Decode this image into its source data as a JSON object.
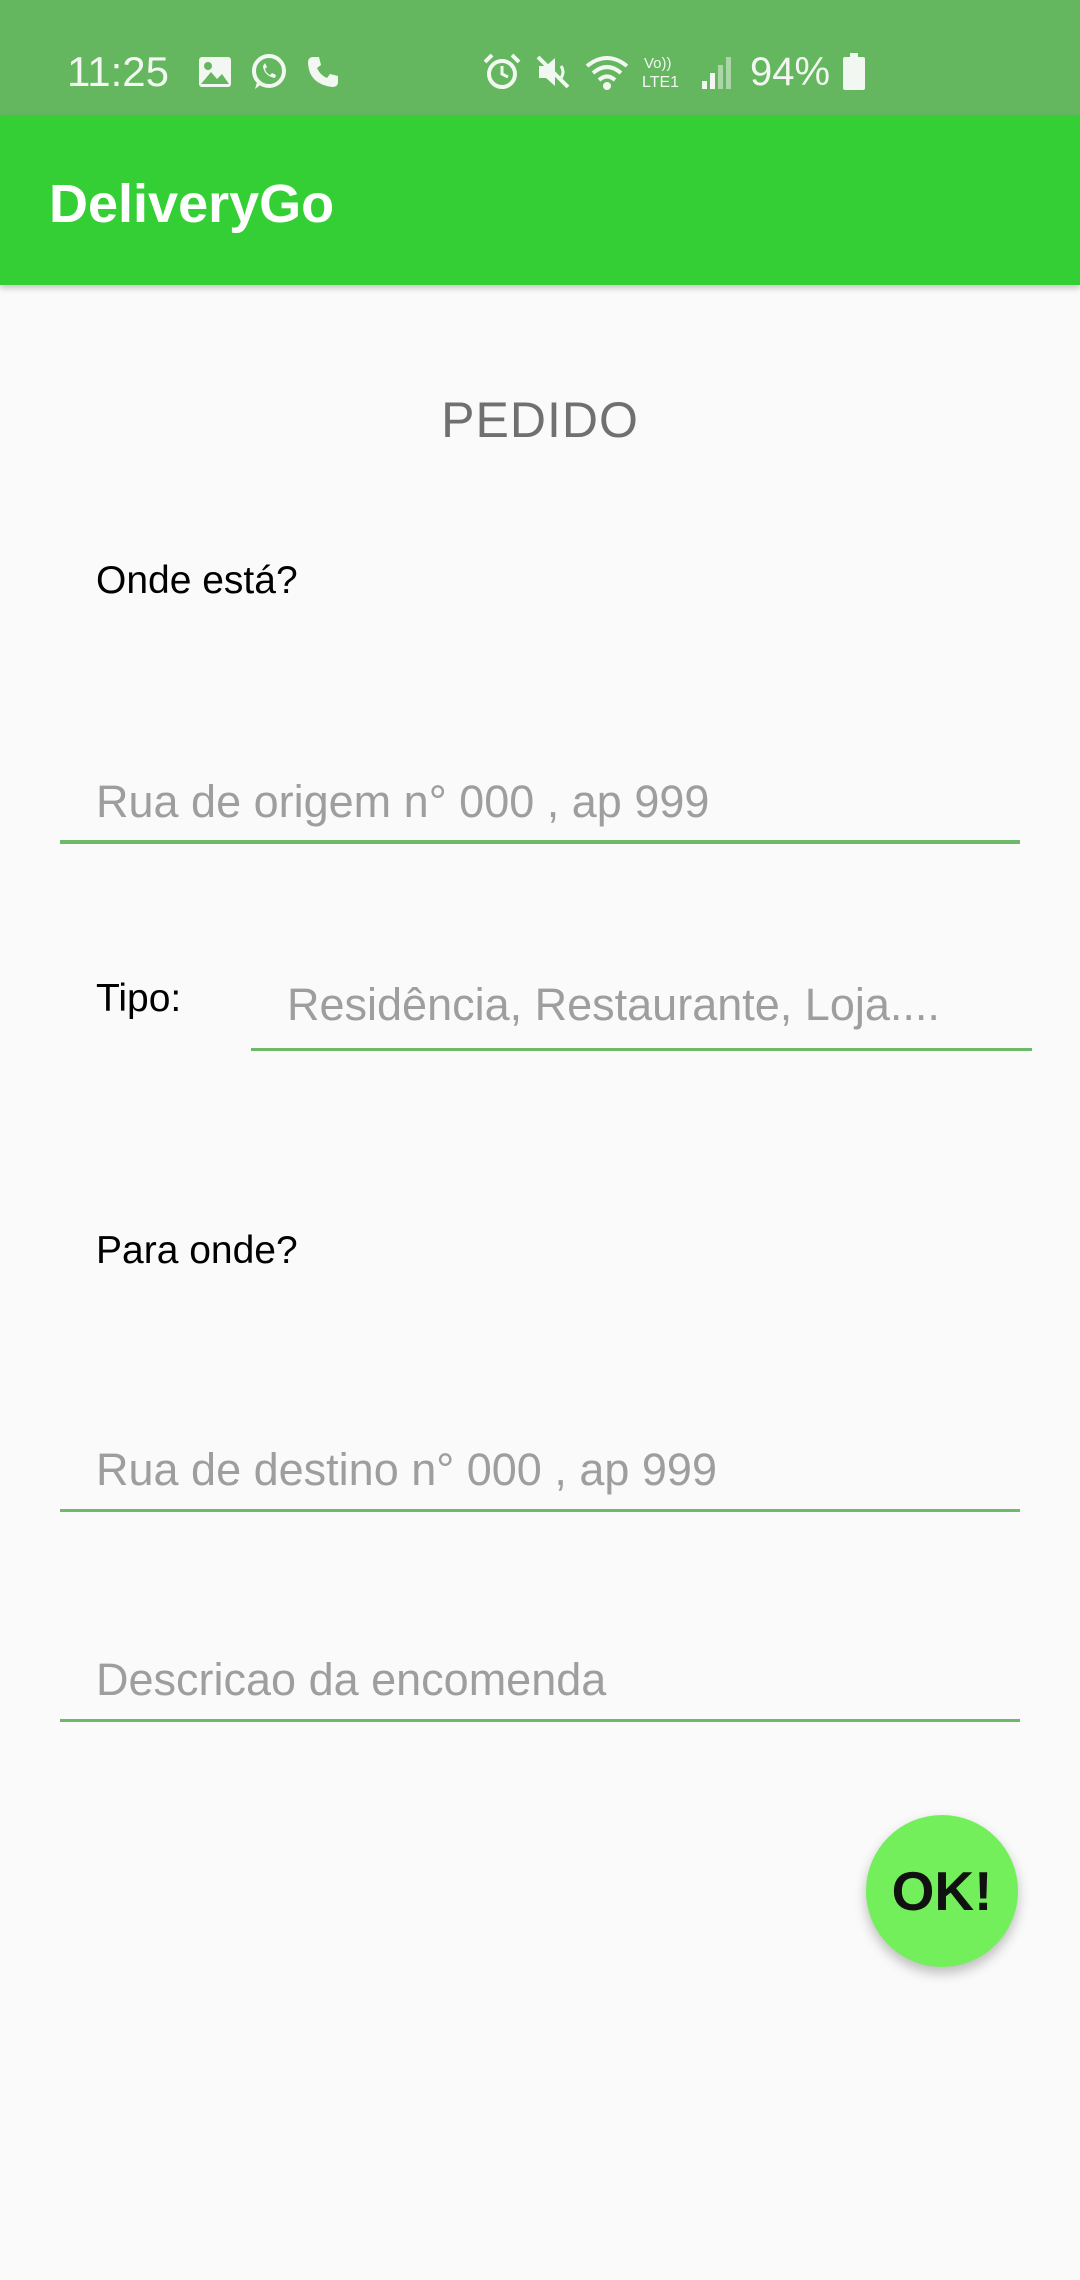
{
  "status_bar": {
    "time": "11:25",
    "battery": "94%",
    "network_label": "Vo)) LTE1",
    "left_icons": [
      "image-icon",
      "whatsapp-icon",
      "phone-icon"
    ],
    "right_icons": [
      "alarm-icon",
      "mute-icon",
      "wifi-icon",
      "lte-icon",
      "signal-icon",
      "battery-icon"
    ]
  },
  "app_bar": {
    "title": "DeliveryGo"
  },
  "form": {
    "title": "PEDIDO",
    "origin_label": "Onde está?",
    "origin_placeholder": "Rua de origem n° 000 , ap 999",
    "type_label": "Tipo:",
    "type_placeholder": "Residência, Restaurante, Loja....",
    "destination_label": "Para onde?",
    "destination_placeholder": "Rua de destino n° 000 , ap 999",
    "description_placeholder": "Descricao da encomenda",
    "submit_label": "OK!"
  },
  "colors": {
    "status_bar": "#64b75e",
    "app_bar": "#34cf34",
    "underline": "#6cb96a",
    "fab": "#74ef5c",
    "background": "#fafafa"
  }
}
